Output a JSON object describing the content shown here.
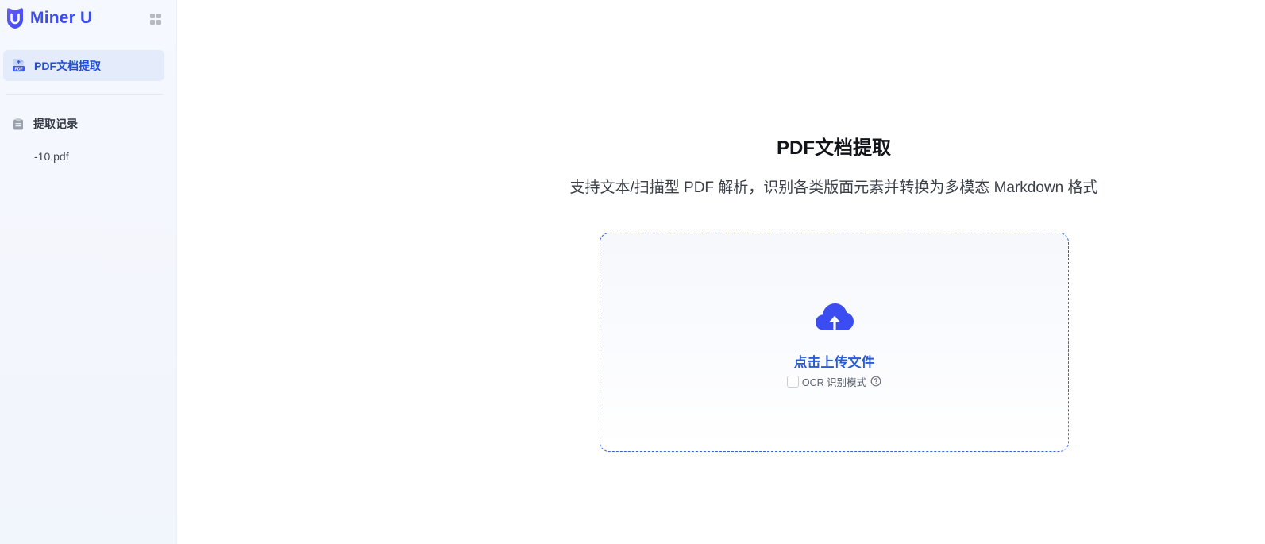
{
  "brand": {
    "name": "Miner U",
    "color": "#3b4cf0"
  },
  "sidebar": {
    "active_item": {
      "label": "PDF文档提取",
      "icon": "pdf-file-icon"
    },
    "history": {
      "title": "提取记录",
      "icon": "clipboard-icon",
      "items": [
        {
          "label": "-10.pdf"
        }
      ]
    }
  },
  "main": {
    "title": "PDF文档提取",
    "subtitle": "支持文本/扫描型 PDF 解析，识别各类版面元素并转换为多模态 Markdown 格式",
    "upload": {
      "label": "点击上传文件",
      "icon": "cloud-upload-icon",
      "accent": "#3b4cf0"
    },
    "ocr": {
      "label": "OCR 识别模式",
      "checked": false,
      "help_icon": "question-circle-icon"
    }
  }
}
